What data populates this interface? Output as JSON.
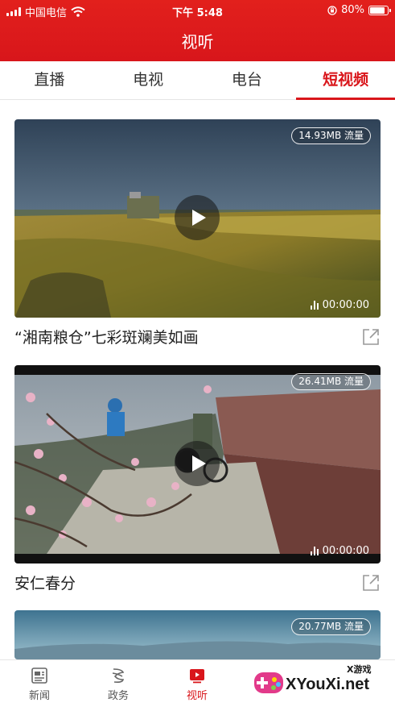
{
  "status_bar": {
    "carrier": "中国电信",
    "time": "下午 5:48",
    "battery": "80%"
  },
  "header": {
    "title": "视听"
  },
  "tabs": [
    {
      "label": "直播",
      "active": false
    },
    {
      "label": "电视",
      "active": false
    },
    {
      "label": "电台",
      "active": false
    },
    {
      "label": "短视频",
      "active": true
    }
  ],
  "videos": [
    {
      "data_size": "14.93MB 流量",
      "duration": "00:00:00",
      "title": "“湘南粮仓”七彩斑斓美如画"
    },
    {
      "data_size": "26.41MB 流量",
      "duration": "00:00:00",
      "title": "安仁春分"
    },
    {
      "data_size": "20.77MB 流量",
      "duration": "",
      "title": ""
    }
  ],
  "bottom_nav": [
    {
      "label": "新闻",
      "icon": "news-icon",
      "active": false
    },
    {
      "label": "政务",
      "icon": "government-icon",
      "active": false
    },
    {
      "label": "视听",
      "icon": "video-icon",
      "active": true
    }
  ],
  "watermark": {
    "brand": "XYouXi.net",
    "small": "X游戏"
  },
  "colors": {
    "accent": "#d9161b",
    "header_bg": "#e2201c"
  }
}
